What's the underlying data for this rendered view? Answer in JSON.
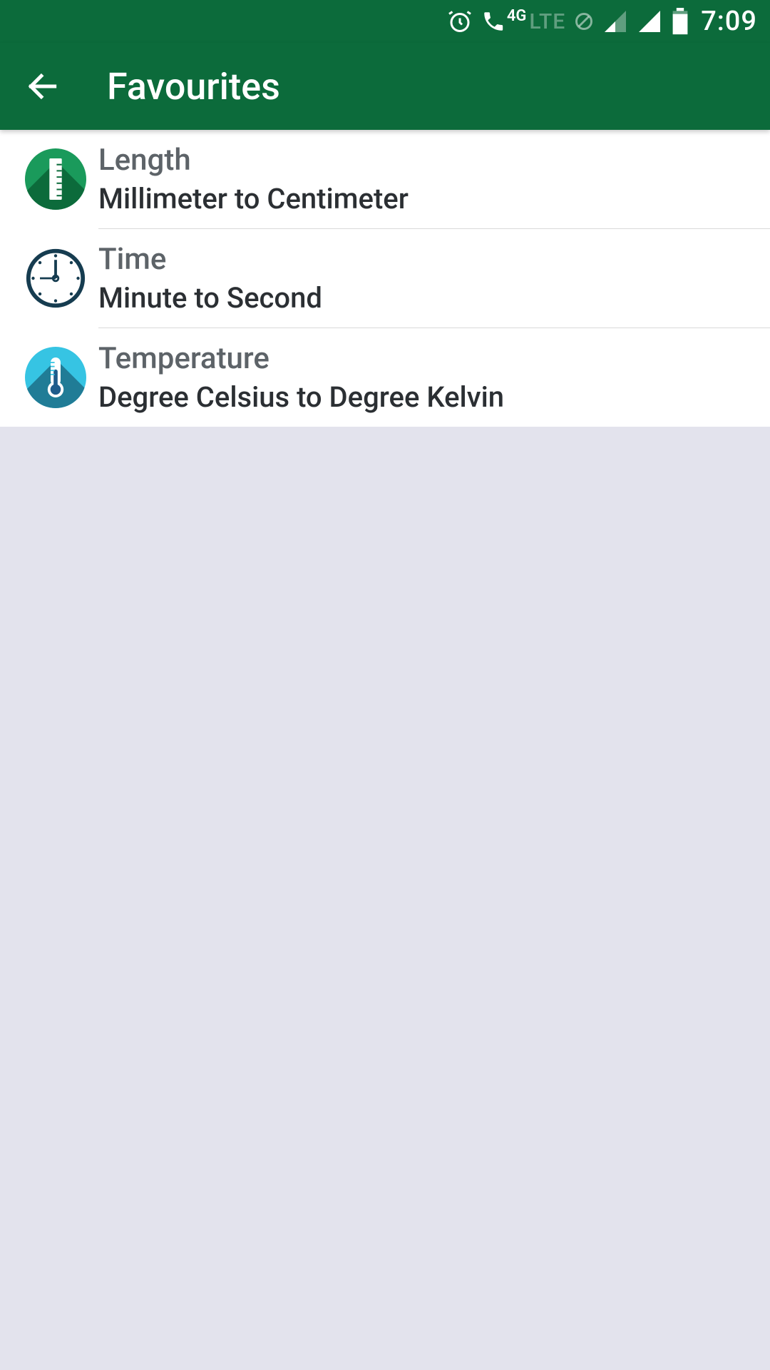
{
  "status": {
    "fourg_label": "4G",
    "lte_label": "LTE",
    "time": "7:09"
  },
  "appbar": {
    "title": "Favourites"
  },
  "favourites": [
    {
      "icon": "ruler-icon",
      "category": "Length",
      "conversion": "Millimeter to Centimeter"
    },
    {
      "icon": "clock-icon",
      "category": "Time",
      "conversion": "Minute to Second"
    },
    {
      "icon": "thermometer-icon",
      "category": "Temperature",
      "conversion": "Degree Celsius to Degree Kelvin"
    }
  ]
}
